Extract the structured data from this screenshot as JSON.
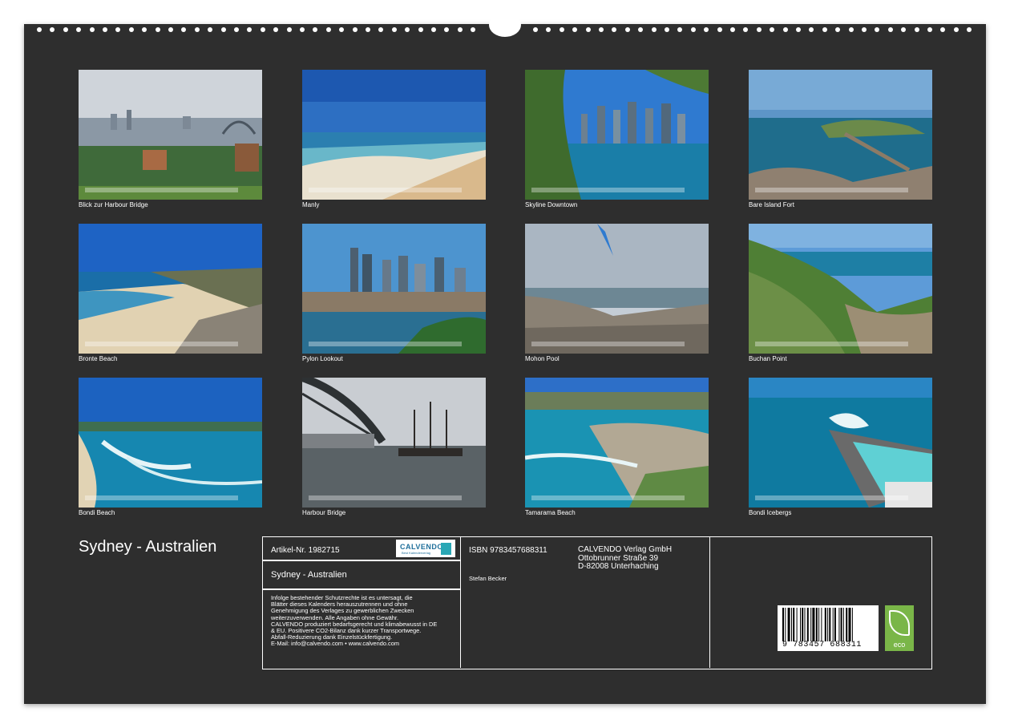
{
  "photos": [
    {
      "caption": "Blick zur Harbour Bridge",
      "scene": "harbour-city"
    },
    {
      "caption": "Manly",
      "scene": "beach-wide"
    },
    {
      "caption": "Skyline Downtown",
      "scene": "skyline-water"
    },
    {
      "caption": "Bare Island Fort",
      "scene": "island-bridge"
    },
    {
      "caption": "Bronte Beach",
      "scene": "beach-cove"
    },
    {
      "caption": "Pylon Lookout",
      "scene": "city-harbour"
    },
    {
      "caption": "Mohon Pool",
      "scene": "rocks-cloudy"
    },
    {
      "caption": "Buchan Point",
      "scene": "green-headland"
    },
    {
      "caption": "Bondi Beach",
      "scene": "bondi"
    },
    {
      "caption": "Harbour Bridge",
      "scene": "bridge-ship"
    },
    {
      "caption": "Tamarama Beach",
      "scene": "turquoise-bay"
    },
    {
      "caption": "Bondi Icebergs",
      "scene": "pool-waves"
    }
  ],
  "title": "Sydney - Australien",
  "info": {
    "article": "Artikel-Nr. 1982715",
    "calendar_title": "Sydney - Australien",
    "logo_word": "CALVENDO",
    "logo_sub": "Best Kalenderverlag",
    "legal": [
      "Infolge bestehender Schutzrechte ist es untersagt, die",
      "Blätter dieses Kalenders herauszutrennen und ohne",
      "Genehmigung des Verlages zu gewerblichen Zwecken",
      "weiterzuverwenden. Alle Angaben ohne Gewähr.",
      "CALVENDO produziert bedarfsgerecht und klimabewusst in DE",
      "& EU. Positivere CO2-Bilanz dank kurzer Transportwege.",
      "Abfall-Reduzierung dank Einzelstückfertigung.",
      "E-Mail: info@calvendo.com • www.calvendo.com"
    ],
    "isbn": "ISBN 9783457688311",
    "author": "Stefan Becker",
    "publisher": [
      "CALVENDO Verlag GmbH",
      "Ottobrunner Straße 39",
      "D-82008 Unterhaching"
    ],
    "barcode_digits": "9 783457 688311",
    "eco_label": "eco"
  }
}
